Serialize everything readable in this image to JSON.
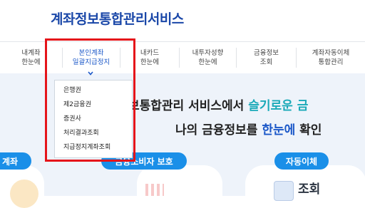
{
  "header": {
    "title": "계좌정보통합관리서비스"
  },
  "nav": {
    "items": [
      {
        "line1": "내계좌",
        "line2": "한눈에"
      },
      {
        "line1": "본인계좌",
        "line2": "일괄지급정지"
      },
      {
        "line1": "내카드",
        "line2": "한눈에"
      },
      {
        "line1": "내투자성향",
        "line2": "한눈에"
      },
      {
        "line1": "금융정보",
        "line2": "조회"
      },
      {
        "line1": "계좌자동이체",
        "line2": "통합관리"
      }
    ]
  },
  "dropdown": {
    "items": [
      "은행권",
      "제2금융권",
      "증권사",
      "처리결과조회",
      "지급정지계좌조회"
    ]
  },
  "hero": {
    "line1_prefix": "보통합관리 서비스에서 ",
    "line1_highlight": "슬기로운 금",
    "line2_prefix": "나의 금융정보를 ",
    "line2_highlight": "한눈에",
    "line2_suffix": " 확인"
  },
  "cards": {
    "left_label": "계좌",
    "center_label": "금융소비자 보호",
    "right_label": "자동이체",
    "right_bottom_text": "조회"
  },
  "colors": {
    "title": "#1a47a8",
    "accent": "#1a57c8",
    "highlight": "#1aa9b8",
    "pill": "#1a8fe8",
    "annotation": "#e5141a"
  }
}
